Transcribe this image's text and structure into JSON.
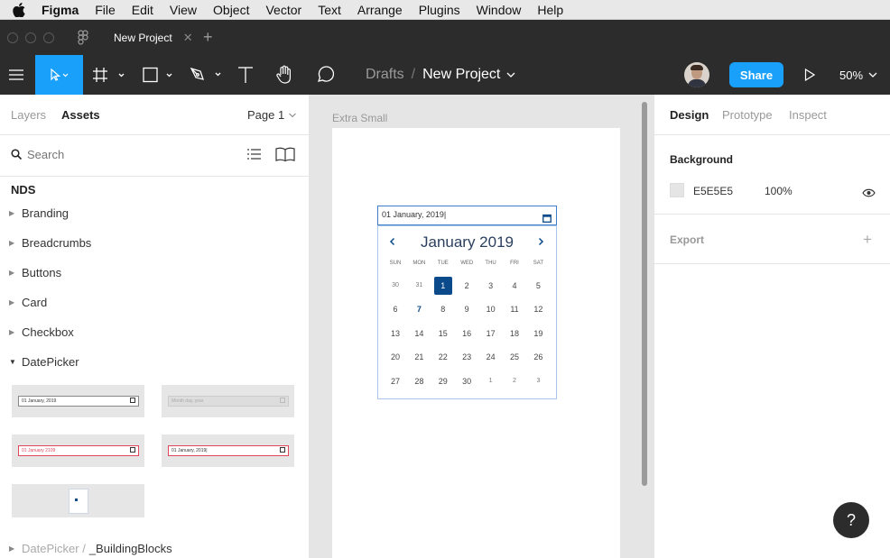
{
  "menubar": {
    "items": [
      "Figma",
      "File",
      "Edit",
      "View",
      "Object",
      "Vector",
      "Text",
      "Arrange",
      "Plugins",
      "Window",
      "Help"
    ]
  },
  "titlebar": {
    "tab_label": "New Project",
    "add_icon": "plus-icon"
  },
  "toolbar": {
    "breadcrumb_root": "Drafts",
    "breadcrumb_sep": "/",
    "project_name": "New Project",
    "share_label": "Share",
    "zoom": "50%",
    "accent": "#18a0fb"
  },
  "left_panel": {
    "tabs": [
      "Layers",
      "Assets"
    ],
    "page_label": "Page 1",
    "search_placeholder": "Search",
    "library_name": "NDS",
    "groups": [
      "Branding",
      "Breadcrumbs",
      "Buttons",
      "Card",
      "Checkbox",
      "DatePicker"
    ],
    "thumbs": {
      "t1": "01 January, 2019",
      "t2": "Month day, year",
      "t3": "01 January 2109",
      "t4": "01 January, 2019|"
    },
    "bottom_group_prefix": "DatePicker /",
    "bottom_group_name": "_BuildingBlocks"
  },
  "canvas": {
    "frame_label": "Extra Small",
    "input_value": "01 January, 2019",
    "month_title": "January 2019",
    "weekdays": [
      "SUN",
      "MON",
      "TUE",
      "WED",
      "THU",
      "FRI",
      "SAT"
    ],
    "weeks": [
      [
        "30",
        "31",
        "1",
        "2",
        "3",
        "4",
        "5"
      ],
      [
        "6",
        "7",
        "8",
        "9",
        "10",
        "11",
        "12"
      ],
      [
        "13",
        "14",
        "15",
        "16",
        "17",
        "18",
        "19"
      ],
      [
        "20",
        "21",
        "22",
        "23",
        "24",
        "25",
        "26"
      ],
      [
        "27",
        "28",
        "29",
        "30",
        "1",
        "2",
        "3"
      ]
    ],
    "selected_day": "1",
    "today_day": "7",
    "selected_color": "#0b4a8b"
  },
  "right_panel": {
    "tabs": [
      "Design",
      "Prototype",
      "Inspect"
    ],
    "background_title": "Background",
    "bg_hex": "E5E5E5",
    "bg_opacity": "100%",
    "export_title": "Export"
  },
  "help_label": "?"
}
